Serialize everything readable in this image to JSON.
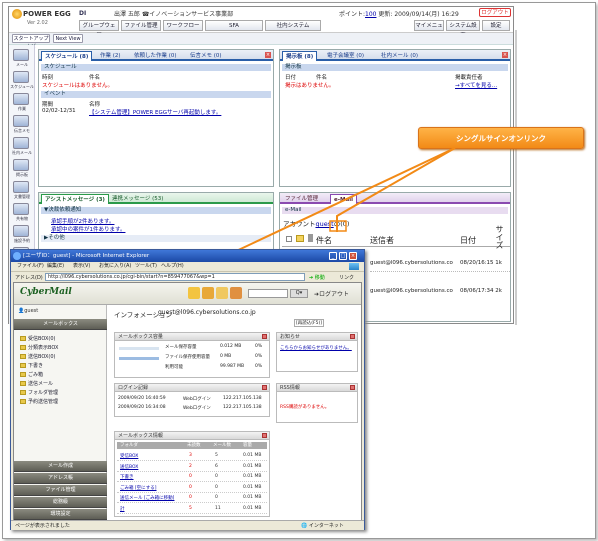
{
  "powerEgg": {
    "logo": "POWER EGG",
    "version": "Ver 2.02",
    "brand": "DI",
    "user": "出澤 五郎 ☎イノベーションサービス事業部",
    "points_label": "ポイント:",
    "points": "100",
    "updated": "更新: 2009/09/14(月) 16:29",
    "logout": "ログアウト",
    "gnav": [
      "グループウェア",
      "ファイル管理",
      "ワークフロー",
      "SFA",
      "社内システム"
    ],
    "right_links": [
      "マイメニュー",
      "システム設定",
      "ヘルプ"
    ],
    "help_label": "設定",
    "subbar": [
      "スタートアップナビ",
      "Next View"
    ],
    "sidebar": [
      "メール",
      "スケジュール",
      "作業",
      "伝言メモ",
      "社内メール",
      "掲示板",
      "文書管理",
      "共有物",
      "施設予約",
      "案件管理",
      "タスク管理",
      "報告"
    ],
    "schedule": {
      "tabs": [
        "スケジュール (8)",
        "作業 (2)",
        "依頼した作業 (0)",
        "伝言メモ (0)"
      ],
      "head": "スケジュール",
      "cols": [
        "時刻",
        "件名"
      ],
      "empty": "スケジュールはありません。",
      "event_head": "イベント",
      "event_cols": [
        "期間",
        "名称"
      ],
      "event_period": "02/02-12/31",
      "event_name": "【システム管理】POWER EGGサーバ再起動します。"
    },
    "board": {
      "tabs": [
        "掲示板 (8)",
        "電子会議室 (0)",
        "社内メール (0)"
      ],
      "head": "掲示板",
      "cols": [
        "日付",
        "件名",
        "掲載責任者"
      ],
      "empty": "掲示はありません。",
      "more": "→すべてを見る..."
    },
    "assist": {
      "tabs": [
        "アシストメッセージ (3)",
        "連携メッセージ (53)"
      ],
      "head": "▼決裁依頼通知",
      "line1": "承認手順が2件あります。",
      "line2": "承認中の案件が1件あります。",
      "other": "▶その他"
    },
    "mail": {
      "tabs": [
        "ファイル管理",
        "e-Mail"
      ],
      "head": "e-Mail",
      "account_label": "アカウント",
      "account": "guest",
      "account_suffix": "の(0)",
      "cols": [
        "件名",
        "送信者",
        "日付",
        "サイズ"
      ],
      "rows": [
        {
          "from": "guest@l096.cybersolutions.co",
          "date": "08/20/16:15 1k"
        },
        {
          "from": "guest@l096.cybersolutions.co",
          "date": "08/06/17:34 2k"
        }
      ]
    }
  },
  "callout": "シングルサインオンリンク",
  "ie": {
    "title": "[ユーザID：guest] - Microsoft Internet Explorer",
    "menu": [
      "ファイル(F)",
      "編集(E)",
      "表示(V)",
      "お気に入り(A)",
      "ツール(T)",
      "ヘルプ(H)"
    ],
    "address_label": "アドレス(D)",
    "address": "http://l096.cybersolutions.co.jp/cgi-bin/start?n=859477067&wp=1",
    "go": "移動",
    "links": "リンク",
    "status_left": "ページが表示されました",
    "status_right": "インターネット"
  },
  "cybermail": {
    "logo": "CyberMail",
    "logout": "ログアウト",
    "user": "guest",
    "info_title": "インフォメーション",
    "info_user": "guest@l096.cybersolutions.co.jp",
    "reload": "[再読込(F5)]",
    "mailbox_head": "メールボックス",
    "folders": [
      "受信BOX(0)",
      "分類表示BOX",
      "送信BOX(0)",
      "下書き",
      "ごみ箱",
      "送信メール",
      "フォルダ管理",
      "予約送信管理"
    ],
    "nav_bottom": [
      "メール作成",
      "アドレス帳",
      "ファイル管理",
      "総務級",
      "環境設定"
    ],
    "mbox_info": {
      "title": "メールボックス容量",
      "rows": [
        {
          "label": "メール保存容量",
          "val": "0.012 MB",
          "pct": "0%"
        },
        {
          "label": "ファイル保存使用容量",
          "val": "0 MB",
          "pct": "0%"
        },
        {
          "label": "利用可能",
          "val": "99.987 MB",
          "pct": "0%"
        }
      ]
    },
    "login": {
      "title": "ログイン記録",
      "rows": [
        {
          "date": "2009/09/20 16:40:59",
          "type": "Webログイン",
          "ip": "122.217.105.138"
        },
        {
          "date": "2009/09/20 16:34:08",
          "type": "Webログイン",
          "ip": "122.217.105.138"
        }
      ]
    },
    "notice": {
      "title": "お知らせ",
      "text": "こちらからお知らせがありません。"
    },
    "rss": {
      "title": "RSS情報",
      "text": "RSS購読がありません。"
    },
    "mbox_table": {
      "title": "メールボックス情報",
      "cols": [
        "フォルダ",
        "未読数",
        "メール数",
        "容量"
      ],
      "rows": [
        {
          "name": "受信BOX",
          "unread": "3",
          "count": "5",
          "size": "0.01 MB"
        },
        {
          "name": "送信BOX",
          "unread": "2",
          "count": "6",
          "size": "0.01 MB"
        },
        {
          "name": "下書き",
          "unread": "0",
          "count": "0",
          "size": "0.01 MB"
        },
        {
          "name": "ごみ箱 [空にする]",
          "unread": "0",
          "count": "0",
          "size": "0.01 MB"
        },
        {
          "name": "送信メール [ごみ箱に移動]",
          "unread": "0",
          "count": "0",
          "size": "0.01 MB"
        },
        {
          "name": "計",
          "unread": "5",
          "count": "11",
          "size": "0.01 MB"
        }
      ]
    }
  },
  "colors": {
    "accent": "#2a5ea8",
    "callout": "#f28a16",
    "unread": "#dd0000"
  }
}
